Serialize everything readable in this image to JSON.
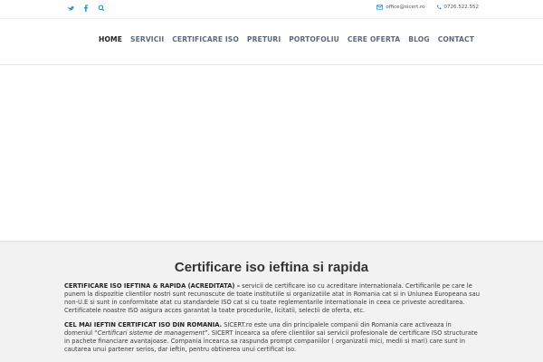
{
  "topbar": {
    "social": [
      {
        "icon": "twitter-icon"
      },
      {
        "icon": "facebook-icon"
      },
      {
        "icon": "search-icon"
      }
    ],
    "email": "office@sicert.ro",
    "phone": "0726.522.552"
  },
  "nav": {
    "items": [
      {
        "label": "HOME",
        "active": true
      },
      {
        "label": "SERVICII"
      },
      {
        "label": "CERTIFICARE ISO"
      },
      {
        "label": "PRETURI"
      },
      {
        "label": "PORTOFOLIU"
      },
      {
        "label": "CERE OFERTA"
      },
      {
        "label": "BLOG"
      },
      {
        "label": "CONTACT"
      }
    ]
  },
  "main": {
    "title": "Certificare iso ieftina si rapida",
    "p1_bold": "CERTIFICARE ISO IEFTINA & RAPIDA (ACREDITATA)  –",
    "p1_text": " servicii de certificare iso cu acreditare internationala. Certificarile pe care le punem la dispozitie clientilor nostri sunt recunoscute de toate institutiile si organizatiile atat in Romania cat si in Uniunea Europeana sau non-U.E si sunt in conformitate atat cu standardele ISO cat si cu toate reglementarile internationale in ceea ce priveste acreditarea. Certificatele noastre ISO asigura acces garantat la toate procedurile, licitatii, selectii de oferta, etc.",
    "p2_bold": "CEL MAI IEFTIN CERTIFICAT ISO DIN ROMANIA.",
    "p2_text1": " SICERT.ro este una din principalele companii din Romania care activeaza in domeniul “",
    "p2_italic": "Certificari sisteme de management",
    "p2_text2": "”. SICERT incearca sa ofere clientilor sai servicii profesionale de certificare ISO structurate in pachete financiare avantajoase. Compania incearca sa raspunda prompt companiilor ( organizatii mici, medii si mari) care sunt in cautarea unui partener serios, dar ieftin, pentru obtinerea unui certificat iso."
  },
  "colors": {
    "accent": "#2a8fd1",
    "nav_text": "#5b6b7c",
    "content_bg": "#f2f2f2"
  }
}
